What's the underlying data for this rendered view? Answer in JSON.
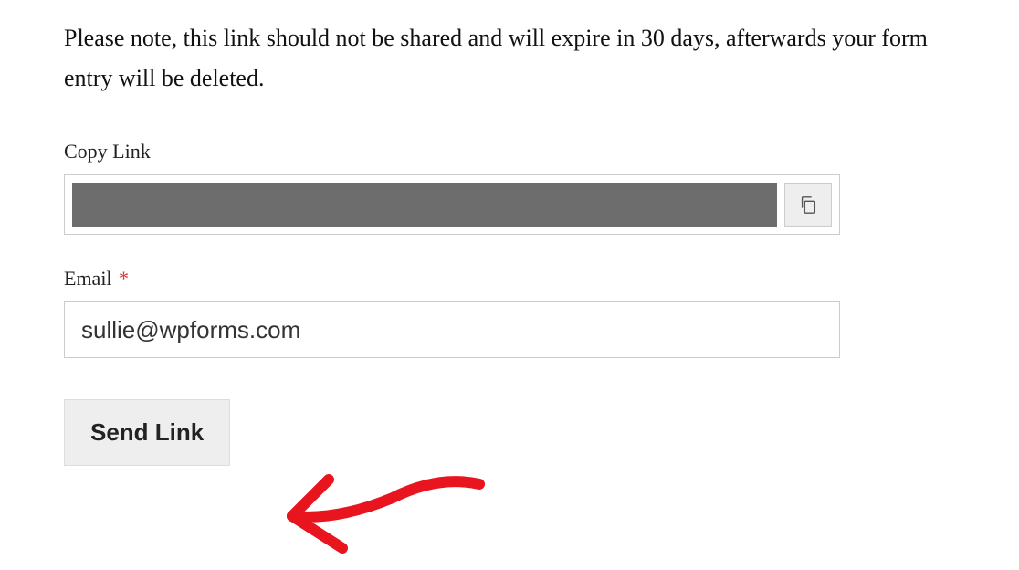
{
  "description": "Please note, this link should not be shared and will expire in 30 days, afterwards your form entry will be deleted.",
  "copyLink": {
    "label": "Copy Link"
  },
  "email": {
    "label": "Email",
    "required": "*",
    "value": "sullie@wpforms.com"
  },
  "submit": {
    "label": "Send Link"
  }
}
